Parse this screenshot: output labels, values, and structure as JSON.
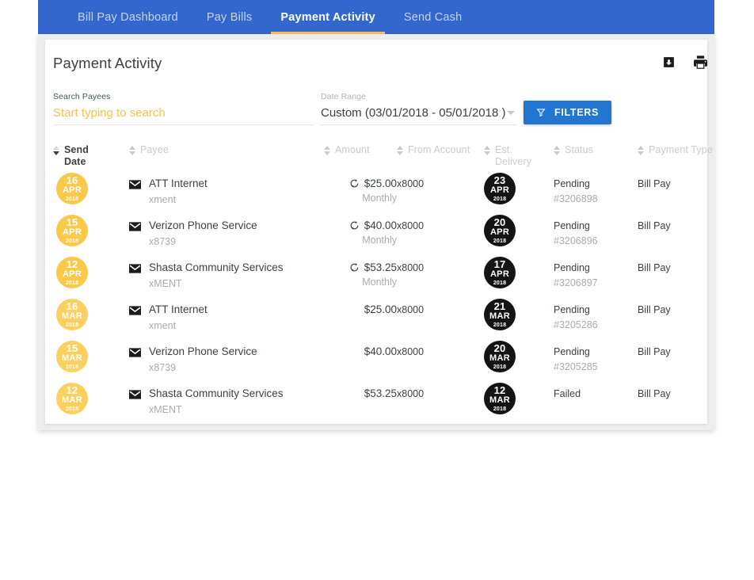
{
  "nav": {
    "items": [
      {
        "label": "Bill Pay Dashboard",
        "active": false
      },
      {
        "label": "Pay Bills",
        "active": false
      },
      {
        "label": "Payment Activity",
        "active": true
      },
      {
        "label": "Send Cash",
        "active": false
      }
    ],
    "bar_color": "#3467ce",
    "active_underline_color": "#ffc34d"
  },
  "header": {
    "title": "Payment Activity",
    "actions": [
      {
        "name": "download-icon",
        "label": "Download"
      },
      {
        "name": "print-icon",
        "label": "Print"
      }
    ]
  },
  "search": {
    "label": "Search Payees",
    "placeholder": "Start typing to search",
    "value": "",
    "placeholder_color": "#f9c349"
  },
  "date_range": {
    "label": "Date Range",
    "value": "Custom (03/01/2018 - 05/01/2018 )"
  },
  "filters_button": {
    "label": "FILTERS",
    "icon": "filter-funnel-icon",
    "color": "#2276d2"
  },
  "table": {
    "columns": [
      {
        "key": "send_date",
        "label": "Send\nDate",
        "line1": "Send",
        "line2": "Date",
        "sorted": true,
        "direction": "desc"
      },
      {
        "key": "payee",
        "label": "Payee",
        "line1": "Payee",
        "line2": "",
        "sorted": false
      },
      {
        "key": "amount",
        "label": "Amount",
        "line1": "Amount",
        "line2": "",
        "sorted": false
      },
      {
        "key": "from_account",
        "label": "From Account",
        "line1": "From Account",
        "line2": "",
        "sorted": false
      },
      {
        "key": "est_delivery",
        "label": "Est. Delivery",
        "line1": "Est.",
        "line2": "Delivery",
        "sorted": false
      },
      {
        "key": "status",
        "label": "Status",
        "line1": "Status",
        "line2": "",
        "sorted": false
      },
      {
        "key": "payment_type",
        "label": "Payment Type",
        "line1": "Payment Type",
        "line2": "",
        "sorted": false
      }
    ],
    "rows": [
      {
        "send_date": {
          "day": "16",
          "month": "APR",
          "year": "2018",
          "tone": "amber"
        },
        "payee": {
          "name": "ATT Internet",
          "sub": "xment",
          "icon": "envelope-icon"
        },
        "amount": {
          "value": "$25.00",
          "frequency": "Monthly",
          "recurring": true
        },
        "from_account": "x8000",
        "est_delivery": {
          "day": "23",
          "month": "APR",
          "year": "2018"
        },
        "status": {
          "label": "Pending",
          "confirmation": "#3206898"
        },
        "payment_type": "Bill Pay"
      },
      {
        "send_date": {
          "day": "15",
          "month": "APR",
          "year": "2018",
          "tone": "amber"
        },
        "payee": {
          "name": "Verizon Phone Service",
          "sub": "x8739",
          "icon": "envelope-icon"
        },
        "amount": {
          "value": "$40.00",
          "frequency": "Monthly",
          "recurring": true
        },
        "from_account": "x8000",
        "est_delivery": {
          "day": "20",
          "month": "APR",
          "year": "2018"
        },
        "status": {
          "label": "Pending",
          "confirmation": "#3206896"
        },
        "payment_type": "Bill Pay"
      },
      {
        "send_date": {
          "day": "12",
          "month": "APR",
          "year": "2018",
          "tone": "amber"
        },
        "payee": {
          "name": "Shasta Community Services",
          "sub": "xMENT",
          "icon": "envelope-icon"
        },
        "amount": {
          "value": "$53.25",
          "frequency": "Monthly",
          "recurring": true
        },
        "from_account": "x8000",
        "est_delivery": {
          "day": "17",
          "month": "APR",
          "year": "2018"
        },
        "status": {
          "label": "Pending",
          "confirmation": "#3206897"
        },
        "payment_type": "Bill Pay"
      },
      {
        "send_date": {
          "day": "16",
          "month": "MAR",
          "year": "2018",
          "tone": "amber-pale"
        },
        "payee": {
          "name": "ATT Internet",
          "sub": "xment",
          "icon": "envelope-icon"
        },
        "amount": {
          "value": "$25.00",
          "frequency": "",
          "recurring": false
        },
        "from_account": "x8000",
        "est_delivery": {
          "day": "21",
          "month": "MAR",
          "year": "2018"
        },
        "status": {
          "label": "Pending",
          "confirmation": "#3205286"
        },
        "payment_type": "Bill Pay"
      },
      {
        "send_date": {
          "day": "15",
          "month": "MAR",
          "year": "2018",
          "tone": "amber-pale"
        },
        "payee": {
          "name": "Verizon Phone Service",
          "sub": "x8739",
          "icon": "envelope-icon"
        },
        "amount": {
          "value": "$40.00",
          "frequency": "",
          "recurring": false
        },
        "from_account": "x8000",
        "est_delivery": {
          "day": "20",
          "month": "MAR",
          "year": "2018"
        },
        "status": {
          "label": "Pending",
          "confirmation": "#3205285"
        },
        "payment_type": "Bill Pay"
      },
      {
        "send_date": {
          "day": "12",
          "month": "MAR",
          "year": "2018",
          "tone": "amber-pale"
        },
        "payee": {
          "name": "Shasta Community Services",
          "sub": "xMENT",
          "icon": "envelope-icon"
        },
        "amount": {
          "value": "$53.25",
          "frequency": "",
          "recurring": false
        },
        "from_account": "x8000",
        "est_delivery": {
          "day": "12",
          "month": "MAR",
          "year": "2018"
        },
        "status": {
          "label": "Failed",
          "confirmation": ""
        },
        "payment_type": "Bill Pay"
      }
    ]
  }
}
